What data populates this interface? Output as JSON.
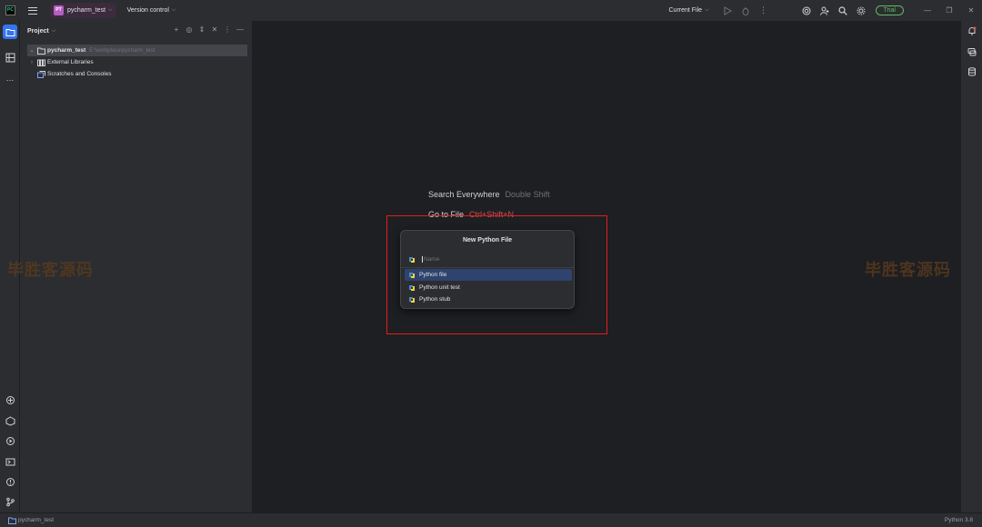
{
  "titlebar": {
    "project_badge": "PT",
    "project_name": "pycharm_test",
    "vcs_label": "Version control",
    "run_config": "Current File",
    "trial_label": "Trial"
  },
  "project_panel": {
    "title": "Project",
    "tree": [
      {
        "label": "pycharm_test",
        "path": "E:\\workplace\\pycharm_test",
        "icon": "folder-icon"
      },
      {
        "label": "External Libraries",
        "icon": "library-icon"
      },
      {
        "label": "Scratches and Consoles",
        "icon": "scratches-icon"
      }
    ]
  },
  "editor": {
    "hints": [
      {
        "label": "Search Everywhere",
        "shortcut": "Double Shift"
      },
      {
        "label": "Go to File",
        "shortcut": "Ctrl+Shift+N"
      }
    ]
  },
  "popup": {
    "title": "New Python File",
    "input_placeholder": "Name",
    "items": [
      {
        "label": "Python file",
        "selected": true
      },
      {
        "label": "Python unit test",
        "selected": false
      },
      {
        "label": "Python stub",
        "selected": false
      }
    ]
  },
  "watermark": {
    "left": "毕胜客源码",
    "right": "毕胜客源码"
  },
  "statusbar": {
    "breadcrumb": "pycharm_test",
    "interpreter": "Python 3.8"
  },
  "colors": {
    "accent": "#3574f0",
    "highlight_box": "#e11d1d",
    "trial": "#5fb865",
    "project_badge": "#b45ec0"
  }
}
